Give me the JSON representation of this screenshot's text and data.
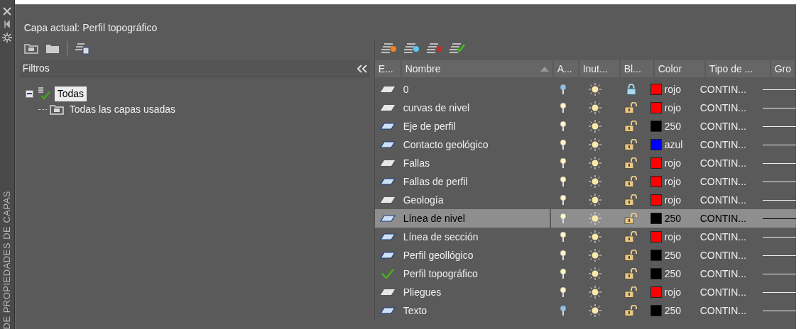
{
  "side_title": "DE PROPIEDADES DE CAPAS",
  "current_layer": "Capa actual: Perfil topográfico",
  "filters": {
    "title": "Filtros",
    "tree": [
      {
        "label": "Todas",
        "selected": true,
        "expanded": true,
        "children": [
          {
            "label": "Todas las capas usadas",
            "selected": false
          }
        ]
      }
    ]
  },
  "table": {
    "columns": [
      "E...",
      "Nombre",
      "A...",
      "Inut...",
      "Bl...",
      "Color",
      "Tipo de ...",
      "Gro"
    ],
    "rows": [
      {
        "kind": "unused",
        "name": "0",
        "on": false,
        "frozen": false,
        "locked": true,
        "color": "#ff0000",
        "color_name": "rojo",
        "linetype": "CONTIN...",
        "selected": false
      },
      {
        "kind": "unused",
        "name": "curvas de nivel",
        "on": true,
        "frozen": false,
        "locked": false,
        "color": "#ff0000",
        "color_name": "rojo",
        "linetype": "CONTIN...",
        "selected": false
      },
      {
        "kind": "used",
        "name": "Eje de perfil",
        "on": true,
        "frozen": false,
        "locked": false,
        "color": "#000000",
        "color_name": "250",
        "linetype": "CONTIN...",
        "selected": false
      },
      {
        "kind": "used",
        "name": "Contacto geológico",
        "on": true,
        "frozen": false,
        "locked": false,
        "color": "#0000ff",
        "color_name": "azul",
        "linetype": "CONTIN...",
        "selected": false
      },
      {
        "kind": "unused",
        "name": "Fallas",
        "on": true,
        "frozen": false,
        "locked": false,
        "color": "#ff0000",
        "color_name": "rojo",
        "linetype": "CONTIN...",
        "selected": false
      },
      {
        "kind": "used",
        "name": "Fallas de perfil",
        "on": true,
        "frozen": false,
        "locked": false,
        "color": "#ff0000",
        "color_name": "rojo",
        "linetype": "CONTIN...",
        "selected": false
      },
      {
        "kind": "unused",
        "name": "Geología",
        "on": true,
        "frozen": false,
        "locked": false,
        "color": "#ff0000",
        "color_name": "rojo",
        "linetype": "CONTIN...",
        "selected": false
      },
      {
        "kind": "used",
        "name": "Línea de nivel",
        "on": true,
        "frozen": false,
        "locked": false,
        "color": "#000000",
        "color_name": "250",
        "linetype": "CONTIN...",
        "selected": true
      },
      {
        "kind": "used",
        "name": "Línea de sección",
        "on": true,
        "frozen": false,
        "locked": false,
        "color": "#ff0000",
        "color_name": "rojo",
        "linetype": "CONTIN...",
        "selected": false
      },
      {
        "kind": "used",
        "name": "Perfil geollógico",
        "on": true,
        "frozen": false,
        "locked": false,
        "color": "#000000",
        "color_name": "250",
        "linetype": "CONTIN...",
        "selected": false
      },
      {
        "kind": "current",
        "name": "Perfil topográfico",
        "on": true,
        "frozen": false,
        "locked": false,
        "color": "#000000",
        "color_name": "250",
        "linetype": "CONTIN...",
        "selected": false
      },
      {
        "kind": "unused",
        "name": "Pliegues",
        "on": true,
        "frozen": false,
        "locked": false,
        "color": "#ff0000",
        "color_name": "rojo",
        "linetype": "CONTIN...",
        "selected": false
      },
      {
        "kind": "used",
        "name": "Texto",
        "on": false,
        "frozen": false,
        "locked": false,
        "color": "#000000",
        "color_name": "250",
        "linetype": "CONTIN...",
        "selected": false
      }
    ]
  }
}
